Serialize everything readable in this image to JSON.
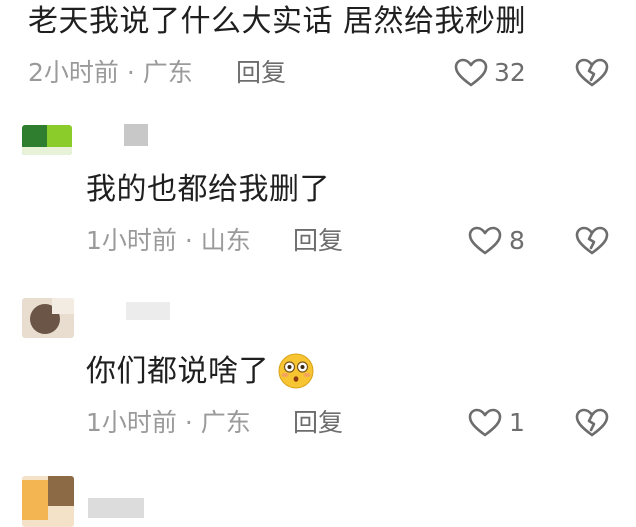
{
  "comments": [
    {
      "text": "老天我说了什么大实话 居然给我秒删",
      "time": "2小时前",
      "location": "广东",
      "reply": "回复",
      "likes": "32"
    },
    {
      "text": "我的也都给我删了",
      "time": "1小时前",
      "location": "山东",
      "reply": "回复",
      "likes": "8"
    },
    {
      "text": "你们都说啥了",
      "emoji": "flushed-face-emoji",
      "time": "1小时前",
      "location": "广东",
      "reply": "回复",
      "likes": "1"
    }
  ],
  "separator": "·",
  "colors": {
    "text": "#1f1f1f",
    "meta": "#9a9a9a",
    "icon": "#6d6d6d",
    "background": "#ffffff"
  },
  "icons": [
    "heart-outline-icon",
    "broken-heart-icon"
  ]
}
